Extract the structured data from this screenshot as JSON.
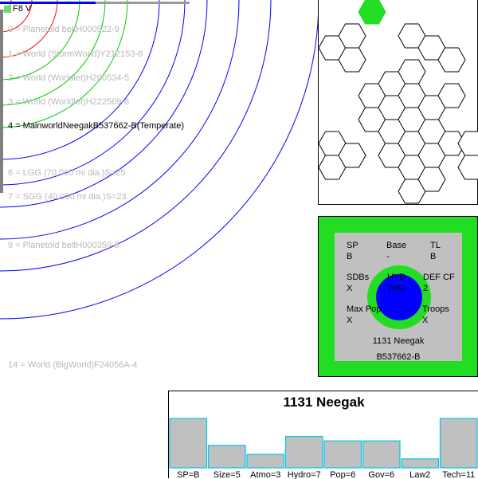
{
  "star": {
    "label": "F8 V",
    "swatch_color": "#6bdc6b"
  },
  "orbits": [
    {
      "label": "0 = Planetoid beltH000522-9",
      "mainworld": false
    },
    {
      "label": "1 = World  (StormWorld)Y212153-6",
      "mainworld": false
    },
    {
      "label": "2 = World  (Worldlet)H200534-5",
      "mainworld": false
    },
    {
      "label": "3 = World  (Worldlet)H222569-8",
      "mainworld": false
    },
    {
      "label": "4 = MainworldNeegakB537662-B(Temperate)",
      "mainworld": true
    },
    {
      "label": "6 = LGG (70,000 mi dia.)S=25",
      "mainworld": false
    },
    {
      "label": "7 = SGG (40,000 mi dia.)S=23",
      "mainworld": false
    },
    {
      "label": "9 = Planetoid beltH000359-8",
      "mainworld": false
    },
    {
      "label": "14 = World  (BigWorld)F24056A-4",
      "mainworld": false
    }
  ],
  "hex_map": {
    "highlight_color": "#22dd22"
  },
  "uwp": {
    "fields": {
      "sp": {
        "label": "SP",
        "value": "B"
      },
      "base": {
        "label": "Base",
        "value": "-"
      },
      "tl": {
        "label": "TL",
        "value": "B"
      },
      "sdbs": {
        "label": "SDBs",
        "value": "X"
      },
      "hyd": {
        "label": "HYD",
        "value": "70%"
      },
      "def_cf": {
        "label": "DEF CF",
        "value": "2"
      },
      "max_pop": {
        "label": "Max Pop",
        "value": "X"
      },
      "troops": {
        "label": "Troops",
        "value": "X"
      }
    },
    "hex_name": "1131 Neegak",
    "uwp_code": "B537662-B",
    "outer_color": "#22dd22",
    "planet_color": "#0000ff",
    "inner_color": "#c0c0c0"
  },
  "chart_data": {
    "type": "bar",
    "title": "1131 Neegak",
    "categories": [
      "SP=B",
      "Size=5",
      "Atmo=3",
      "Hydro=7",
      "Pop=6",
      "Gov=6",
      "Law2",
      "Tech=11"
    ],
    "values": [
      11,
      5,
      3,
      7,
      6,
      6,
      2,
      11
    ],
    "ylim": [
      0,
      11
    ],
    "bar_color": "#c0c0c0",
    "bar_edge_color": "#00c8e8"
  }
}
